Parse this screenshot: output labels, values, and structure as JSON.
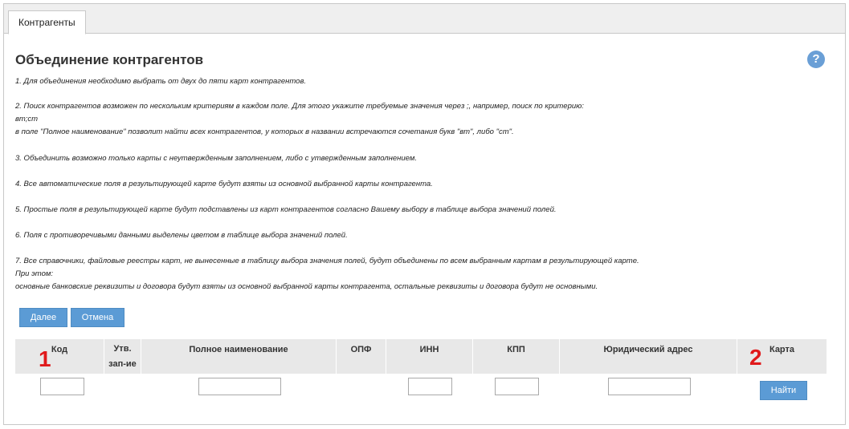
{
  "tab": {
    "label": "Контрагенты"
  },
  "page": {
    "title": "Объединение контрагентов",
    "help_glyph": "?"
  },
  "instructions": {
    "l1": "1. Для объединения необходимо выбрать от двух до пяти карт контрагентов.",
    "l2": "2. Поиск контрагентов возможен по нескольким критериям в каждом поле. Для этого укажите требуемые значения через ;, например, поиск по критерию:",
    "l3": "вт;ст",
    "l4": "в поле \"Полное наименование\" позволит найти всех контрагентов, у которых в названии встречаются сочетания букв \"вт\", либо \"ст\".",
    "l5": "3. Объединить возможно только карты с неутвержденным заполнением, либо с утвержденным заполнением.",
    "l6": "4. Все автоматические поля в результирующей карте будут взяты из основной выбранной карты контрагента.",
    "l7": "5. Простые поля в результирующей карте будут подставлены из карт контрагентов согласно Вашему выбору в таблице выбора значений полей.",
    "l8": "6. Поля с противоречивыми данными выделены цветом в таблице выбора значений полей.",
    "l9": "7. Все справочники, файловые реестры карт, не вынесенные в таблицу выбора значения полей, будут объединены по всем выбранным картам в результирующей карте.",
    "l10": "При этом:",
    "l11": "основные банковские реквизиты и договора будут взяты из основной выбранной карты контрагента, остальные реквизиты и договора будут не основными."
  },
  "buttons": {
    "next": "Далее",
    "cancel": "Отмена",
    "find": "Найти"
  },
  "table": {
    "columns": {
      "code": "Код",
      "approved_line1": "Утв.",
      "approved_line2": "зап-ие",
      "full_name": "Полное наименование",
      "opf": "ОПФ",
      "inn": "ИНН",
      "kpp": "КПП",
      "legal_address": "Юридический адрес",
      "card": "Карта"
    },
    "markers": {
      "first": "1",
      "second": "2"
    },
    "filters": {
      "code": "",
      "full_name": "",
      "inn": "",
      "kpp": "",
      "legal_address": ""
    }
  },
  "colors": {
    "accent": "#5b9bd5",
    "marker": "#e0191b",
    "header_bg": "#e8e8e8"
  }
}
